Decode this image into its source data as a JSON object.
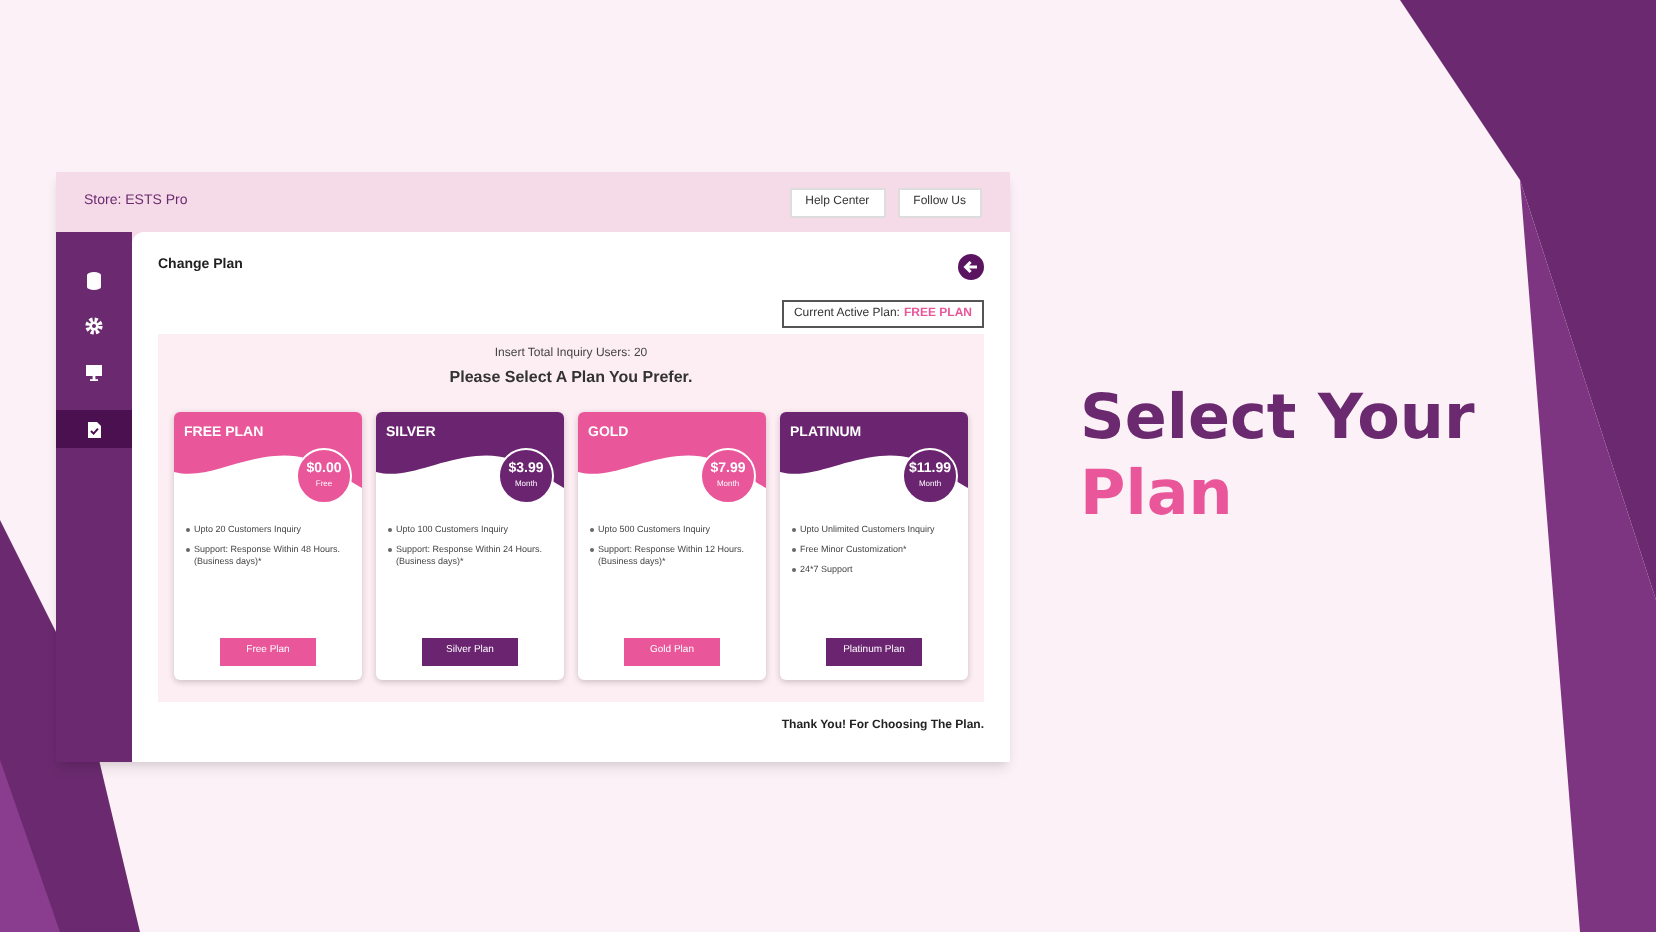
{
  "store": "Store: ESTS Pro",
  "top_buttons": [
    "Help Center",
    "Follow Us"
  ],
  "sidebar": [
    {
      "selected": false
    },
    {
      "selected": false
    },
    {
      "selected": false
    },
    {
      "selected": true
    }
  ],
  "page_title": "Change Plan",
  "current_plan": {
    "label": "Current Active Plan:",
    "value": "FREE PLAN"
  },
  "inquiry_users": "Insert Total Inquiry Users: 20",
  "prompt": "Please Select A Plan You Prefer.",
  "plans": [
    {
      "name": "FREE PLAN",
      "price": "$0.00",
      "period": "Free",
      "color": "#e9579a",
      "features": [
        "Upto 20 Customers Inquiry",
        "Support: Response Within 48 Hours. (Business days)*"
      ],
      "button": "Free Plan"
    },
    {
      "name": "SILVER",
      "price": "$3.99",
      "period": "Month",
      "color": "#6a2470",
      "features": [
        "Upto 100 Customers Inquiry",
        "Support: Response Within 24 Hours. (Business days)*"
      ],
      "button": "Silver Plan"
    },
    {
      "name": "GOLD",
      "price": "$7.99",
      "period": "Month",
      "color": "#e9579a",
      "features": [
        "Upto 500 Customers Inquiry",
        "Support: Response Within 12 Hours. (Business days)*"
      ],
      "button": "Gold Plan"
    },
    {
      "name": "PLATINUM",
      "price": "$11.99",
      "period": "Month",
      "color": "#6a2470",
      "features": [
        "Upto Unlimited Customers Inquiry",
        "Free Minor Customization*",
        "24*7 Support"
      ],
      "button": "Platinum Plan"
    }
  ],
  "thanks": "Thank You! For Choosing The Plan.",
  "headline": [
    "Select Your",
    "Plan"
  ]
}
